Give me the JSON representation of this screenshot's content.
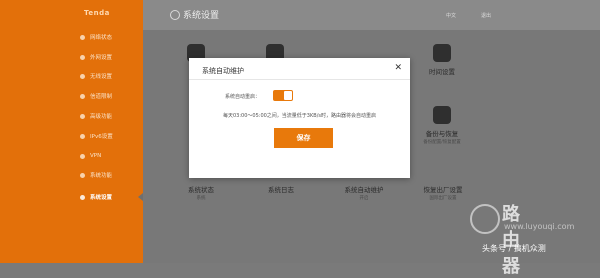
{
  "app": {
    "logo": "Tenda"
  },
  "sidebar": {
    "items": [
      {
        "label": "网络状态"
      },
      {
        "label": "外网设置"
      },
      {
        "label": "无线设置"
      },
      {
        "label": "信道限制"
      },
      {
        "label": "高级功能"
      },
      {
        "label": "IPv6设置"
      },
      {
        "label": "VPN"
      },
      {
        "label": "系统功能"
      },
      {
        "label": "系统设置"
      }
    ]
  },
  "header": {
    "title": "系统设置",
    "lang": "中文",
    "logout": "退出"
  },
  "tiles": [
    {
      "label": "时间设置",
      "desc": ""
    },
    {
      "label": "备份与恢复",
      "desc": "备份配置/恢复配置"
    },
    {
      "label": "系统状态",
      "desc": "系统"
    },
    {
      "label": "系统日志",
      "desc": ""
    },
    {
      "label": "系统自动维护",
      "desc": "开启"
    },
    {
      "label": "恢复出厂设置",
      "desc": "国际出厂设置"
    }
  ],
  "dialog": {
    "title": "系统自动维护",
    "field_label": "系统自动重启：",
    "toggle_on": true,
    "note": "每天03:00～05:00之间，当流量低于3KB/s时，路由器将会自动重启",
    "save_label": "保存"
  },
  "watermark": {
    "big": "路由器",
    "small": "www.luyouqi.com"
  },
  "credit": "头条号 / 搞机众测",
  "colors": {
    "accent": "#e8790b",
    "sidebar": "#e3700a"
  }
}
